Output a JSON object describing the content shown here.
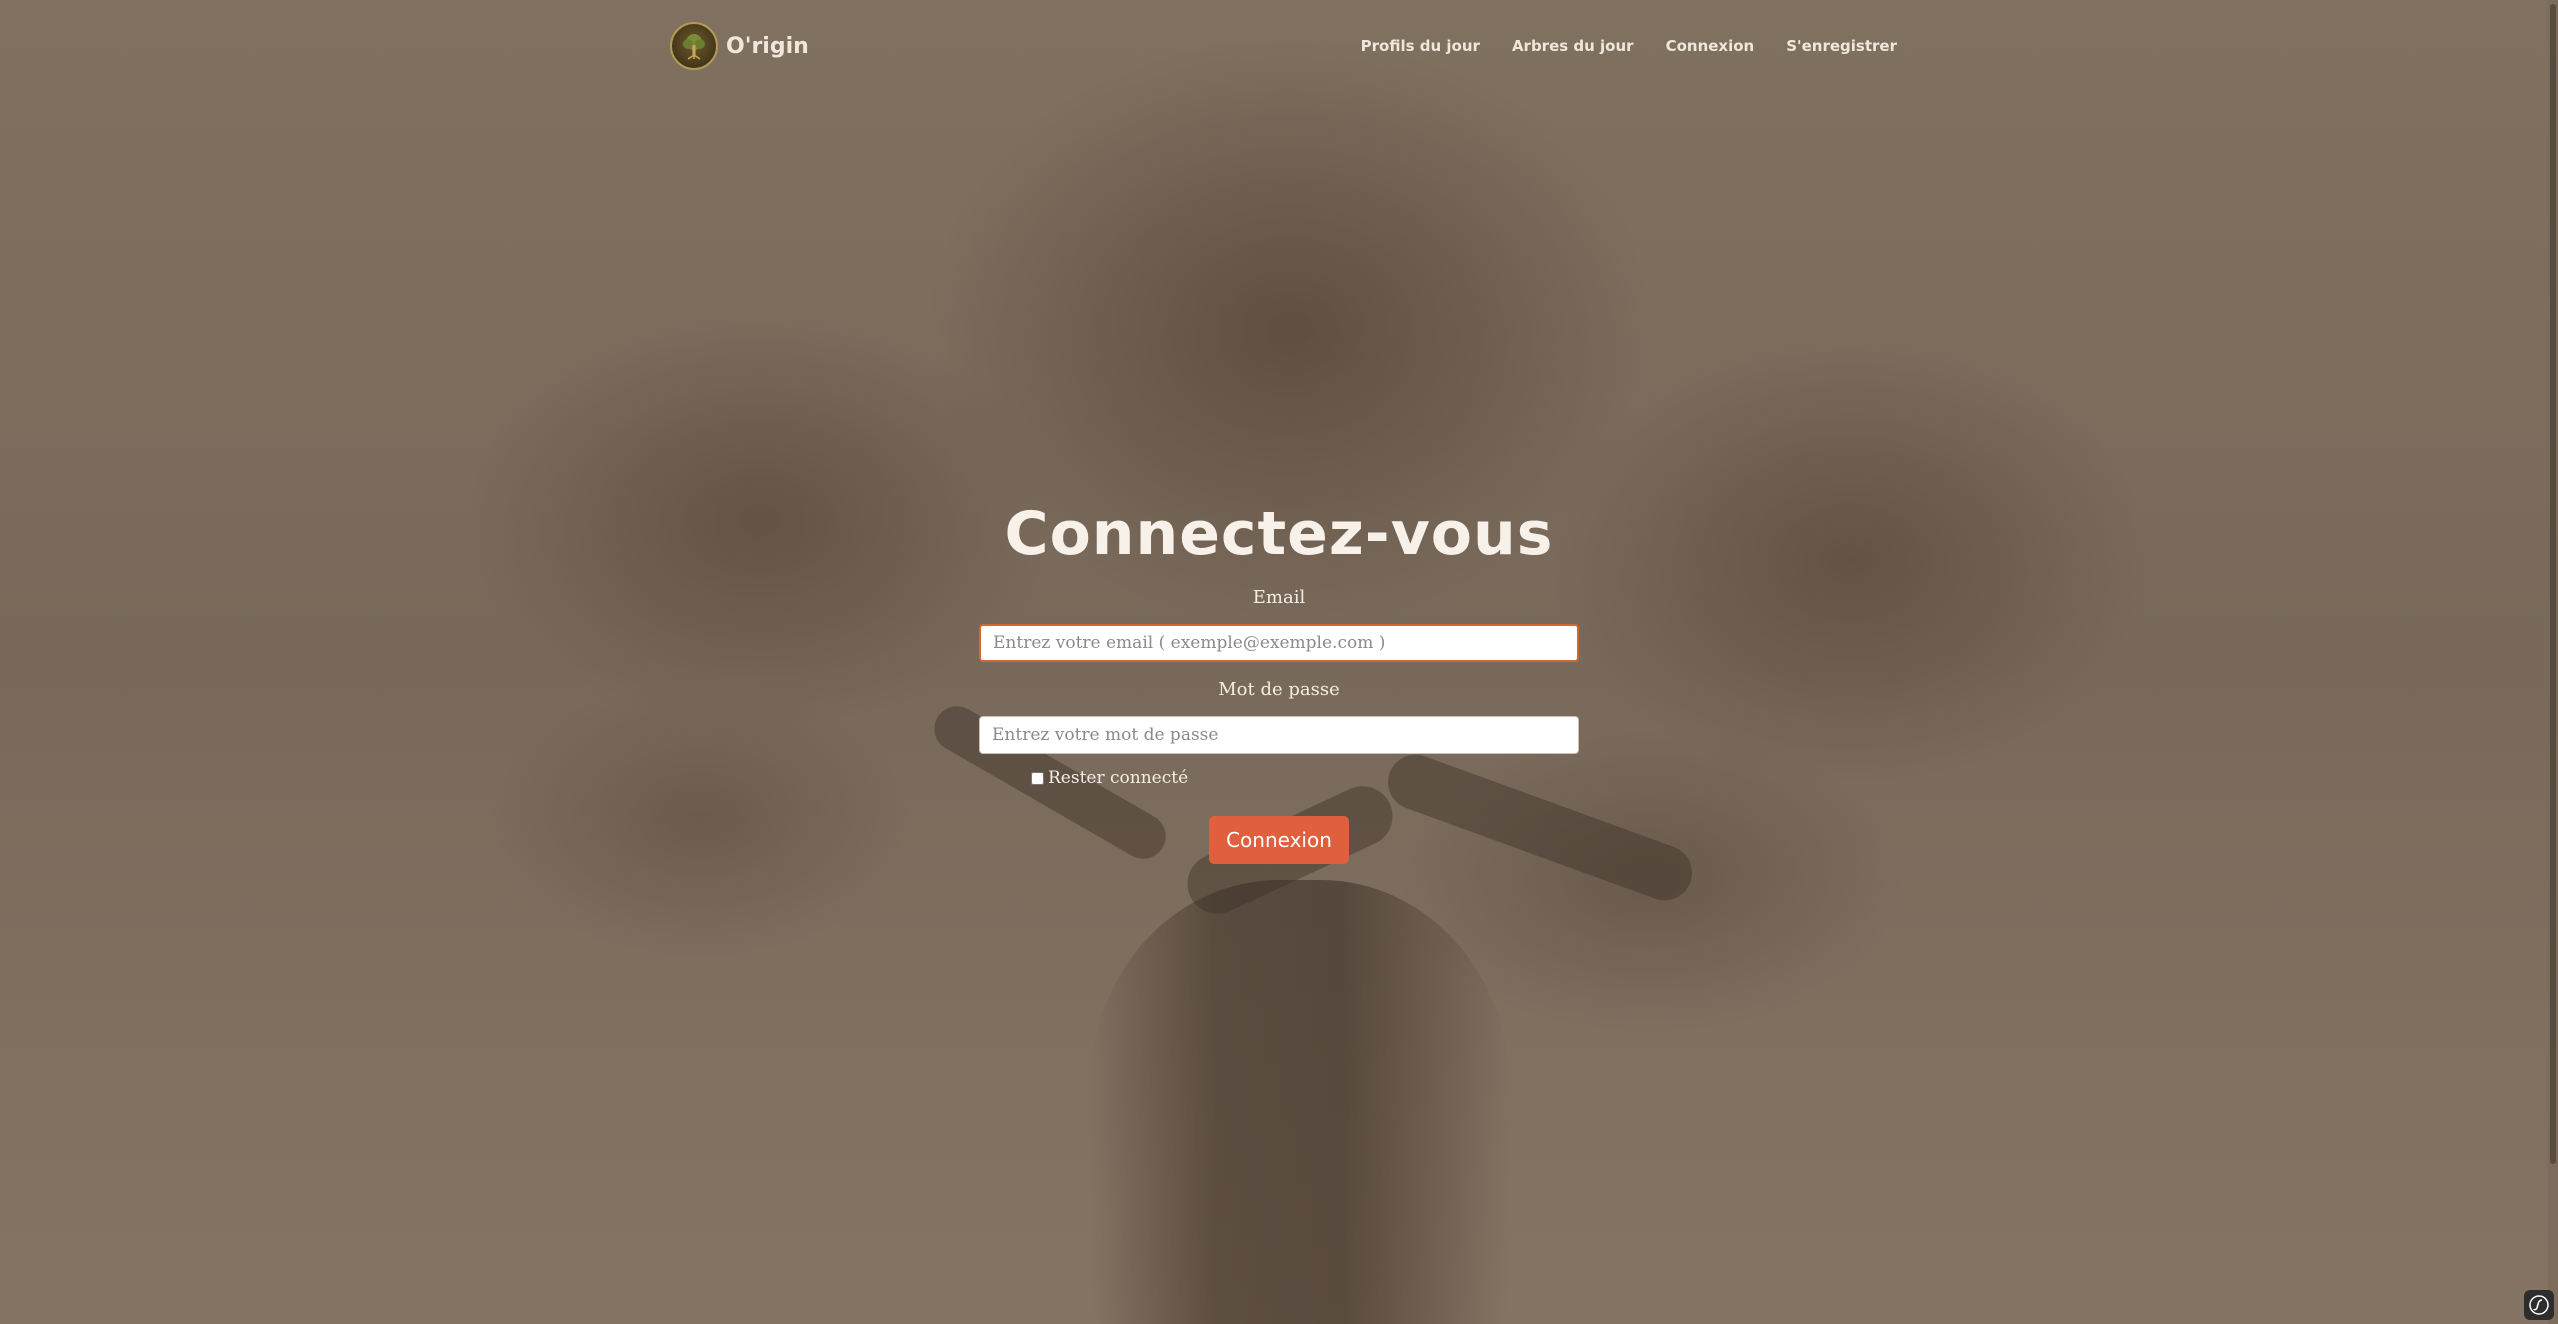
{
  "brand": {
    "name": "O'rigin",
    "logo_icon": "tree-logo-icon"
  },
  "nav": {
    "items": [
      "Profils du jour",
      "Arbres du jour",
      "Connexion",
      "S'enregistrer"
    ]
  },
  "login": {
    "title": "Connectez-vous",
    "email_label": "Email",
    "email_placeholder": "Entrez votre email ( exemple@exemple.com )",
    "email_value": "",
    "password_label": "Mot de passe",
    "password_placeholder": "Entrez votre mot de passe",
    "password_value": "",
    "remember_label": "Rester connecté",
    "remember_checked": false,
    "submit_label": "Connexion"
  },
  "colors": {
    "accent": "#e0603d",
    "background": "#7d6b5b",
    "text_light": "#f4ede5"
  },
  "debug_toolbar": {
    "icon": "symfony-icon"
  }
}
